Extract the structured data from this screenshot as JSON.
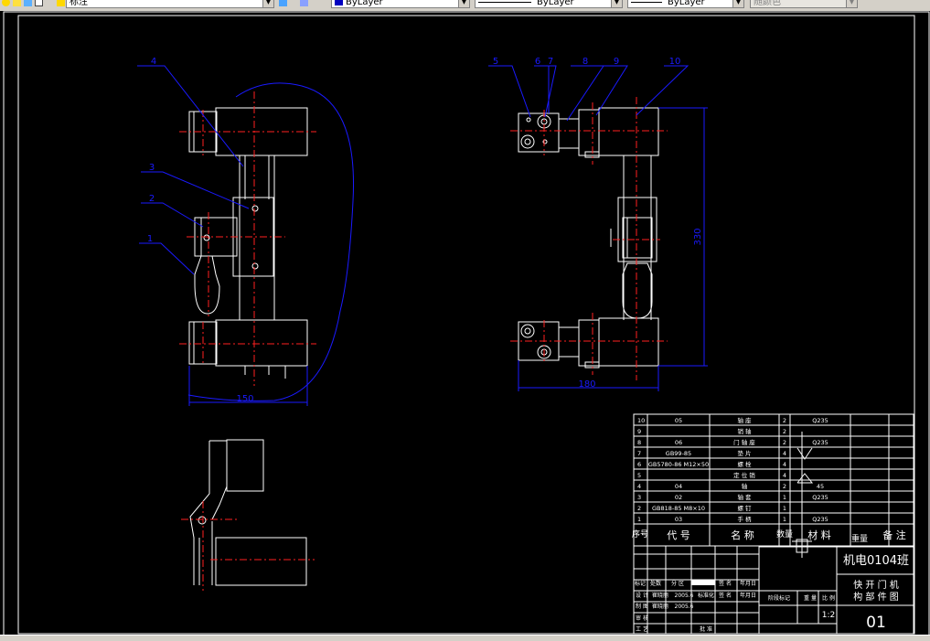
{
  "toolbar": {
    "text_style": "标注",
    "layer": "ByLayer",
    "linetype": "ByLayer",
    "lineweight": "ByLayer",
    "plot_style": "随颜色"
  },
  "drawing": {
    "front_view": {
      "balloons": [
        "4",
        "3",
        "2",
        "1"
      ],
      "dim_width": "150"
    },
    "side_view": {
      "balloons": [
        "5",
        "6",
        "7",
        "8",
        "9",
        "10"
      ],
      "dim_width": "180",
      "dim_height": "330"
    }
  },
  "title_block": {
    "parts": [
      {
        "no": "10",
        "code": "05",
        "name": "轴 座",
        "qty": "2",
        "material": "Q235"
      },
      {
        "no": "9",
        "code": "",
        "name": "销 轴",
        "qty": "2",
        "material": ""
      },
      {
        "no": "8",
        "code": "06",
        "name": "门 轴 座",
        "qty": "2",
        "material": "Q235"
      },
      {
        "no": "7",
        "code": "GB99-85",
        "name": "垫 片",
        "qty": "4",
        "material": ""
      },
      {
        "no": "6",
        "code": "GB5780-86 M12×50",
        "name": "螺 栓",
        "qty": "4",
        "material": ""
      },
      {
        "no": "5",
        "code": "",
        "name": "定 位 销",
        "qty": "4",
        "material": ""
      },
      {
        "no": "4",
        "code": "04",
        "name": "轴",
        "qty": "2",
        "material": "45"
      },
      {
        "no": "3",
        "code": "02",
        "name": "轴 套",
        "qty": "1",
        "material": "Q235"
      },
      {
        "no": "2",
        "code": "GB818-85 M8×10",
        "name": "螺 钉",
        "qty": "1",
        "material": ""
      },
      {
        "no": "1",
        "code": "03",
        "name": "手 柄",
        "qty": "1",
        "material": "Q235"
      }
    ],
    "headers": {
      "no": "序号",
      "code": "代 号",
      "name": "名 称",
      "qty": "数量",
      "material": "材 料",
      "weight": "重量",
      "remark": "备 注"
    },
    "class_name": "机电0104班",
    "drawing_title_1": "快 开 门 机",
    "drawing_title_2": "构 部 件 图",
    "drawing_number": "01",
    "scale": "1:2",
    "rows": {
      "mark": "标记",
      "count": "处数",
      "zone": "分 区",
      "sign": "签 名",
      "date": "年月日",
      "design": "设 计",
      "designer": "崔晓丽",
      "design_date": "2005.6",
      "standard": "标准化",
      "draw": "制 图",
      "drafter": "崔晓丽",
      "draw_date": "2005.6",
      "review": "审 核",
      "process": "工 艺",
      "approve": "批 准",
      "stage_mark": "阶段标记",
      "weight": "重 量",
      "ratio": "比 例"
    }
  },
  "colors": {
    "background": "#000000",
    "part": "#ffffff",
    "centerline": "#ff2020",
    "dimension": "#1a1aff",
    "toolbar": "#d4d0c8"
  }
}
